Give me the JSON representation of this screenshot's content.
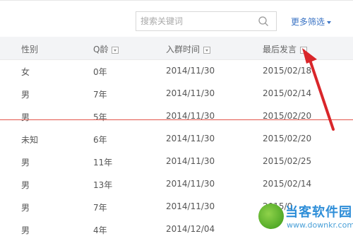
{
  "search": {
    "placeholder": "搜索关键词"
  },
  "filters": {
    "more_label": "更多筛选"
  },
  "table": {
    "columns": [
      "性别",
      "Q龄",
      "入群时间",
      "最后发言"
    ],
    "rows": [
      [
        "女",
        "0年",
        "2014/11/30",
        "2015/02/18"
      ],
      [
        "男",
        "7年",
        "2014/11/30",
        "2015/02/14"
      ],
      [
        "男",
        "5年",
        "2014/11/30",
        "2015/02/20"
      ],
      [
        "未知",
        "6年",
        "2014/11/30",
        "2015/02/20"
      ],
      [
        "男",
        "11年",
        "2014/11/30",
        "2015/02/25"
      ],
      [
        "男",
        "13年",
        "2014/11/30",
        "2015/02/14"
      ],
      [
        "男",
        "7年",
        "2014/11/30",
        "2015/0"
      ],
      [
        "男",
        "4年",
        "2014/12/04",
        ""
      ]
    ]
  },
  "watermark": {
    "title": "当客软件园",
    "url": "www.downkr.com"
  },
  "colors": {
    "link": "#3a73c4",
    "arrow": "#d9262a",
    "header_bg": "#f3f4f6"
  }
}
